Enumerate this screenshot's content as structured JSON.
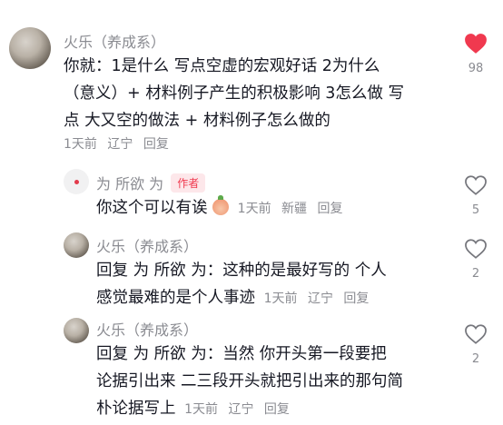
{
  "comment": {
    "author": "火乐（养成系）",
    "lines": [
      "你就：1是什么 写点空虚的宏观好话 2为什么",
      "（意义）+ 材料例子产生的积极影响 3怎么做 写",
      "点 大又空的做法 + 材料例子怎么做的"
    ],
    "time": "1天前",
    "location": "辽宁",
    "reply_label": "回复",
    "likes": "98",
    "liked_color": "#f0394f"
  },
  "replies": [
    {
      "author": "为 所欲 为",
      "badge": "作者",
      "text": "你这个可以有诶",
      "time": "1天前",
      "location": "新疆",
      "reply_label": "回复",
      "likes": "5"
    },
    {
      "author": "火乐（养成系）",
      "lines": [
        "回复 为 所欲 为：这种的是最好写的 个人",
        "感觉最难的是个人事迹"
      ],
      "time": "1天前",
      "location": "辽宁",
      "reply_label": "回复",
      "likes": "2"
    },
    {
      "author": "火乐（养成系）",
      "lines": [
        "回复 为 所欲 为：当然 你开头第一段要把",
        "论据引出来 二三段开头就把引出来的那句简",
        "朴论据写上"
      ],
      "time": "1天前",
      "location": "辽宁",
      "reply_label": "回复",
      "likes": "2"
    }
  ]
}
